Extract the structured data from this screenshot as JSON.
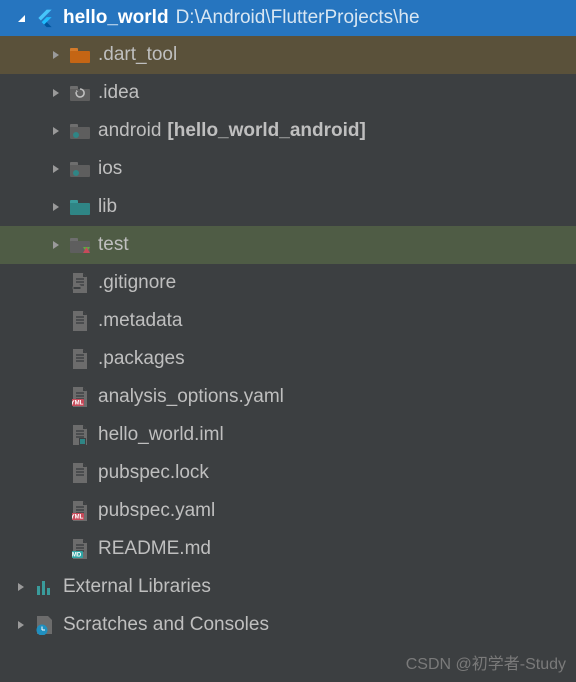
{
  "root": {
    "name": "hello_world",
    "path": "D:\\Android\\FlutterProjects\\he"
  },
  "tree": [
    {
      "label": ".dart_tool",
      "kind": "folder-orange",
      "arrow": "right",
      "hl": "dart"
    },
    {
      "label": ".idea",
      "kind": "folder-spin",
      "arrow": "right"
    },
    {
      "label": "android",
      "kind": "folder-module",
      "arrow": "right",
      "suffix": "[hello_world_android]"
    },
    {
      "label": "ios",
      "kind": "folder-module",
      "arrow": "right"
    },
    {
      "label": "lib",
      "kind": "folder-teal",
      "arrow": "right"
    },
    {
      "label": "test",
      "kind": "folder-test",
      "arrow": "right",
      "hl": "test"
    },
    {
      "label": ".gitignore",
      "kind": "file-gitignore"
    },
    {
      "label": ".metadata",
      "kind": "file-plain"
    },
    {
      "label": ".packages",
      "kind": "file-plain"
    },
    {
      "label": "analysis_options.yaml",
      "kind": "file-yaml"
    },
    {
      "label": "hello_world.iml",
      "kind": "file-iml"
    },
    {
      "label": "pubspec.lock",
      "kind": "file-plain"
    },
    {
      "label": "pubspec.yaml",
      "kind": "file-yaml"
    },
    {
      "label": "README.md",
      "kind": "file-md"
    }
  ],
  "bottom": [
    {
      "label": "External Libraries",
      "kind": "ext-libs",
      "arrow": "right"
    },
    {
      "label": "Scratches and Consoles",
      "kind": "scratches",
      "arrow": "right"
    }
  ],
  "watermark": "CSDN @初学者-Study"
}
